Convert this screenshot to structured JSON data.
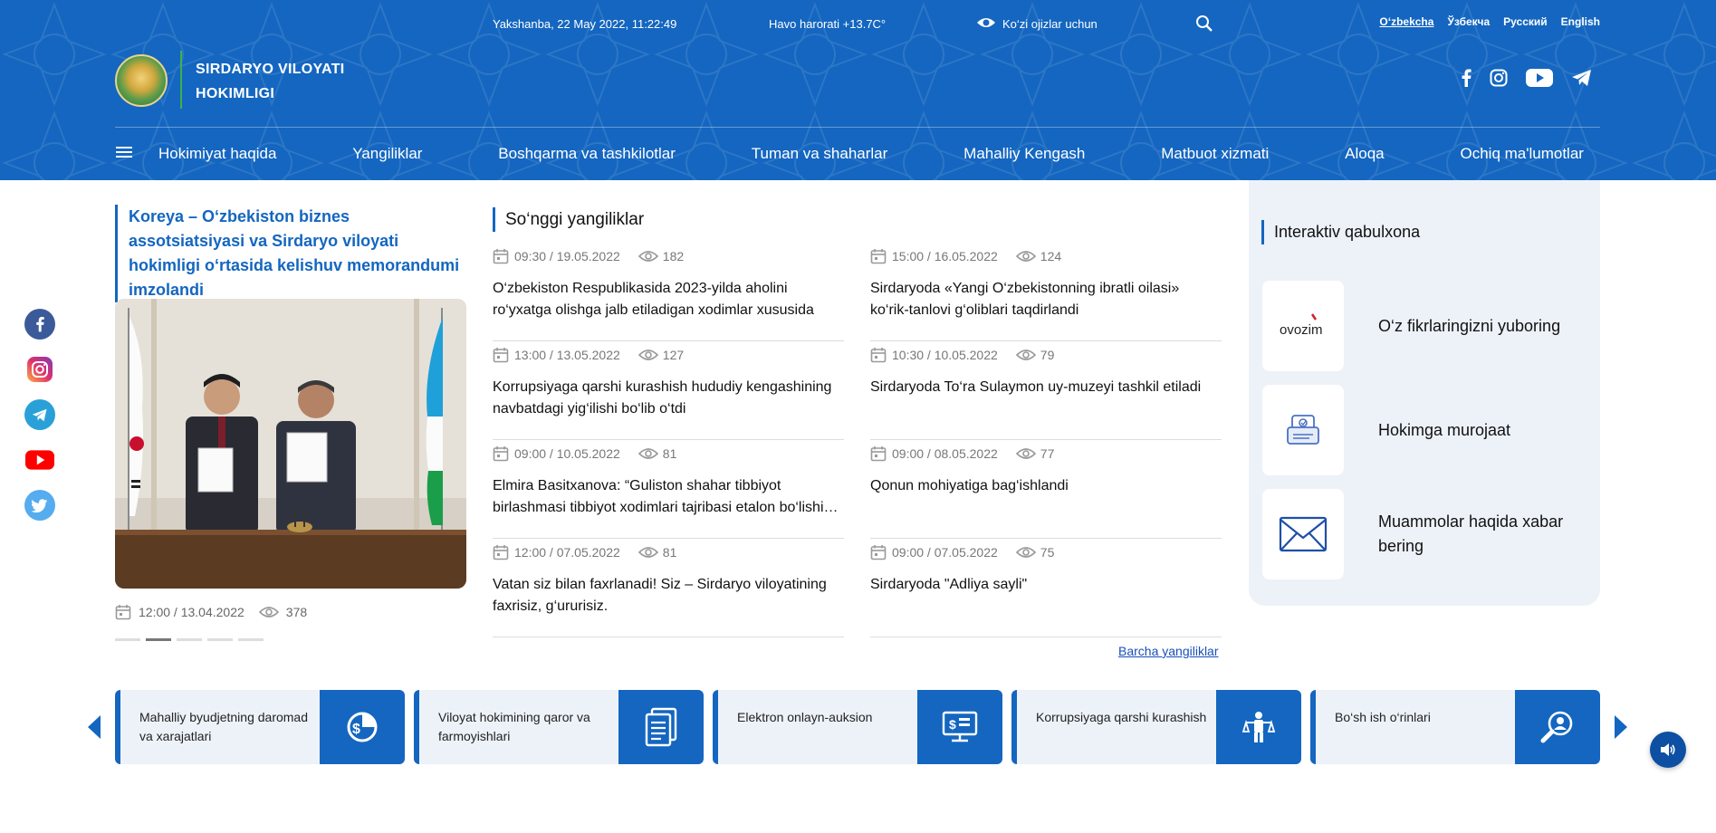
{
  "header": {
    "date": "Yakshanba, 22 May 2022, 11:22:49",
    "weather": "Havo harorati +13.7C°",
    "blind_mode": "Ko‘zi ojizlar uchun",
    "site_title_line1": "SIRDARYO VILOYATI",
    "site_title_line2": "HOKIMLIGI",
    "languages": [
      "O‘zbekcha",
      "Ўзбекча",
      "Русский",
      "English"
    ],
    "socials": [
      "facebook-icon",
      "instagram-icon",
      "youtube-icon",
      "telegram-icon"
    ]
  },
  "nav": {
    "items": [
      "Hokimiyat haqida",
      "Yangiliklar",
      "Boshqarma va tashkilotlar",
      "Tuman va shaharlar",
      "Mahalliy Kengash",
      "Matbuot xizmati",
      "Aloqa",
      "Ochiq ma'lumotlar"
    ]
  },
  "rail": [
    "facebook-icon",
    "instagram-icon",
    "telegram-icon",
    "youtube-icon",
    "twitter-icon"
  ],
  "featured": {
    "title": "Koreya – O‘zbekiston biznes assotsiatsiyasi va Sirdaryo viloyati hokimligi o‘rtasida kelishuv memorandumi imzolandi",
    "date": "12:00 / 13.04.2022",
    "views": "378"
  },
  "latest": {
    "title": "So‘nggi yangiliklar",
    "all_link": "Barcha yangiliklar",
    "items": [
      {
        "date": "09:30 / 19.05.2022",
        "views": "182",
        "title": "O‘zbekiston Respublikasida 2023-yilda aholini ro‘yxatga olishga jalb etiladigan xodimlar xususida"
      },
      {
        "date": "15:00 / 16.05.2022",
        "views": "124",
        "title": "Sirdaryoda «Yangi O‘zbekistonning ibratli oilasi» ko‘rik-tanlovi g‘oliblari taqdirlandi"
      },
      {
        "date": "13:00 / 13.05.2022",
        "views": "127",
        "title": "Korrupsiyaga qarshi kurashish hududiy kengashining navbatdagi yig‘ilishi bo‘lib o‘tdi"
      },
      {
        "date": "10:30 / 10.05.2022",
        "views": "79",
        "title": "Sirdaryoda To‘ra Sulaymon uy-muzeyi tashkil etiladi"
      },
      {
        "date": "09:00 / 10.05.2022",
        "views": "81",
        "title": "Elmira Basitxanova: “Guliston shahar tibbiyot birlashmasi tibbiyot xodimlari tajribasi etalon bo‘lishi…"
      },
      {
        "date": "09:00 / 08.05.2022",
        "views": "77",
        "title": "Qonun mohiyatiga bag‘ishlandi"
      },
      {
        "date": "12:00 / 07.05.2022",
        "views": "81",
        "title": "Vatan siz bilan faxrlanadi! Siz – Sirdaryo viloyatining faxrisiz, g‘ururisiz."
      },
      {
        "date": "09:00 / 07.05.2022",
        "views": "75",
        "title": "Sirdaryoda \"Adliya sayli\""
      }
    ]
  },
  "reception": {
    "title": "Interaktiv qabulxona",
    "items": [
      {
        "label": "O‘z fikrlaringizni yuboring",
        "logo_text": "ovozim",
        "icon": "ovozim-logo"
      },
      {
        "label": "Hokimga murojaat",
        "icon": "appeal-icon"
      },
      {
        "label": "Muammolar haqida xabar bering",
        "icon": "envelope-icon"
      }
    ]
  },
  "cards": [
    {
      "label": "Mahalliy byudjetning daromad va xarajatlari",
      "icon": "budget-icon"
    },
    {
      "label": "Viloyat hokimining qaror va farmoyishlari",
      "icon": "document-icon"
    },
    {
      "label": "Elektron onlayn-auksion",
      "icon": "auction-icon"
    },
    {
      "label": "Korrupsiyaga qarshi kurashish",
      "icon": "anticorruption-icon"
    },
    {
      "label": "Bo‘sh ish o‘rinlari",
      "icon": "vacancy-icon"
    }
  ],
  "colors": {
    "primary": "#1466c0",
    "panel": "#edf2f9"
  }
}
